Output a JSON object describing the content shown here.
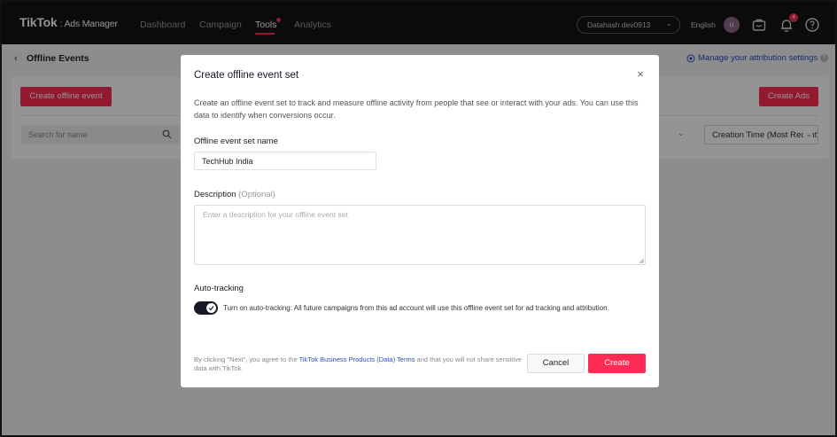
{
  "topnav": {
    "logo": "TikTok",
    "logo_sub": ": Ads Manager",
    "items": [
      {
        "label": "Dashboard"
      },
      {
        "label": "Campaign"
      },
      {
        "label": "Tools"
      },
      {
        "label": "Analytics"
      }
    ],
    "account": "Datahash dev0913",
    "language": "English",
    "avatar_letter": "u",
    "notification_count": "4"
  },
  "page": {
    "title": "Offline Events",
    "attribution_link": "Manage your attribution settings"
  },
  "card": {
    "create_offline_event_label": "Create offline event",
    "create_ads_label": "Create Ads",
    "search_placeholder": "Search for name",
    "sort_value": "Creation Time (Most Recent)"
  },
  "modal": {
    "title": "Create offline event set",
    "description": "Create an offline event set to track and measure offline activity from people that see or interact with your ads. You can use this data to identify when conversions occur.",
    "name_label": "Offline event set name",
    "name_value": "TechHub India",
    "desc_label": "Description",
    "desc_optional": "(Optional)",
    "desc_placeholder": "Enter a description for your offline event set",
    "auto_tracking_label": "Auto-tracking",
    "auto_tracking_text": "Turn on auto-tracking: All future campaigns from this ad account will use this offline event set for ad tracking and attribution.",
    "auto_tracking_on": true,
    "footer_prefix": "By clicking \"Next\", you agree to the ",
    "footer_link": "TikTok Business Products (Data) Terms",
    "footer_suffix": " and that you will not share sensitive data with TikTok.",
    "cancel_label": "Cancel",
    "create_label": "Create"
  },
  "colors": {
    "brand_pink": "#fe2c55",
    "link_blue": "#2c4ebf",
    "nav_bg": "#141414"
  }
}
